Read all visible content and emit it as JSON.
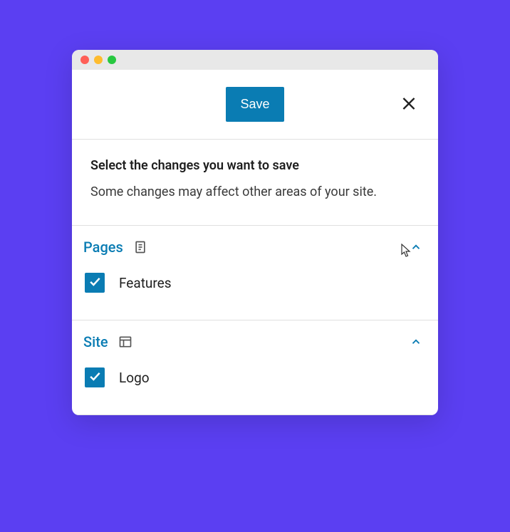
{
  "header": {
    "save_label": "Save"
  },
  "intro": {
    "title": "Select the changes you want to save",
    "description": "Some changes may affect other areas of your site."
  },
  "sections": [
    {
      "title": "Pages",
      "icon": "page-icon",
      "items": [
        {
          "label": "Features",
          "checked": true
        }
      ]
    },
    {
      "title": "Site",
      "icon": "layout-icon",
      "items": [
        {
          "label": "Logo",
          "checked": true
        }
      ]
    }
  ],
  "colors": {
    "accent": "#0a7cb3",
    "background": "#5b3ff2"
  }
}
